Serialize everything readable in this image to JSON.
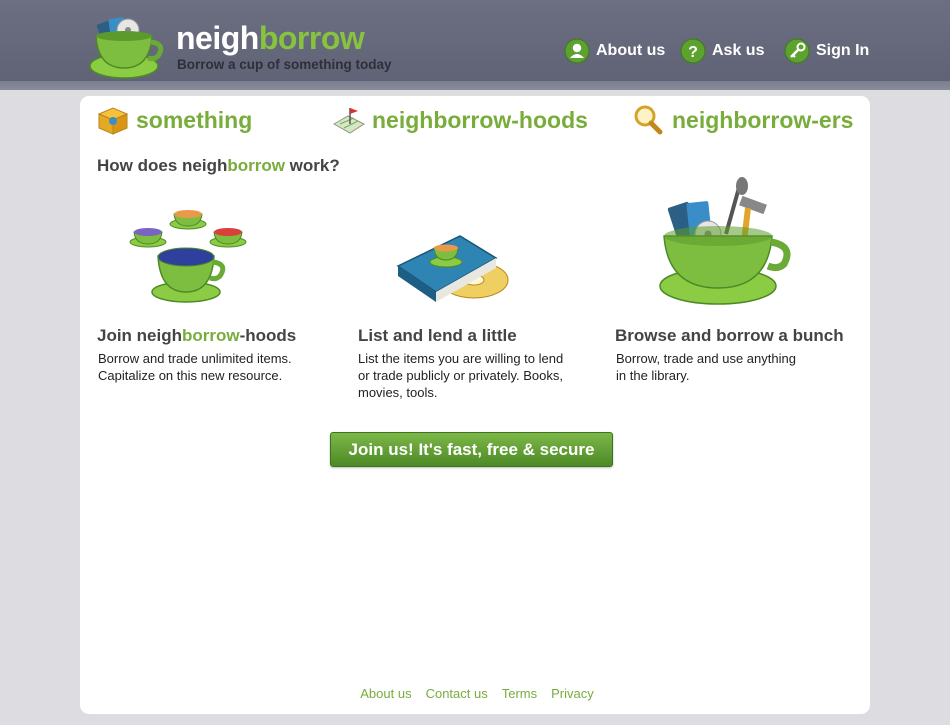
{
  "header": {
    "logo_part1": "neigh",
    "logo_part2": "borrow",
    "tagline": "Borrow a cup of something today",
    "nav": [
      {
        "label": "About us",
        "icon": "person-icon"
      },
      {
        "label": "Ask us",
        "icon": "question-icon"
      },
      {
        "label": "Sign In",
        "icon": "key-icon"
      }
    ]
  },
  "tabs": [
    {
      "label": "something",
      "icon": "box-icon"
    },
    {
      "label": "neighborrow-hoods",
      "icon": "map-icon"
    },
    {
      "label": "neighborrow-ers",
      "icon": "magnifier-icon"
    }
  ],
  "how": {
    "part1": "How does neigh",
    "part2": "borrow",
    "part3": " work?"
  },
  "steps": [
    {
      "title_part1": "Join neigh",
      "title_part2": "borrow",
      "title_part3": "-hoods",
      "desc_line1": "Borrow and trade unlimited items.",
      "desc_line2": "Capitalize on this new resource.",
      "desc_line3": ""
    },
    {
      "title": "List and lend a little",
      "desc_line1": "List the items you are willing to lend",
      "desc_line2": "or trade publicly or privately. Books,",
      "desc_line3": "movies, tools."
    },
    {
      "title": "Browse and borrow a bunch",
      "desc_line1": "Borrow, trade and use anything",
      "desc_line2": "in the library.",
      "desc_line3": ""
    }
  ],
  "cta": {
    "label": "Join us! It's fast, free & secure"
  },
  "footer": {
    "links": [
      "About us",
      "Contact us",
      "Terms",
      "Privacy"
    ]
  },
  "colors": {
    "accent_green": "#78ad3b",
    "header_bg": "#666a7c",
    "page_bg": "#dcdce1"
  }
}
